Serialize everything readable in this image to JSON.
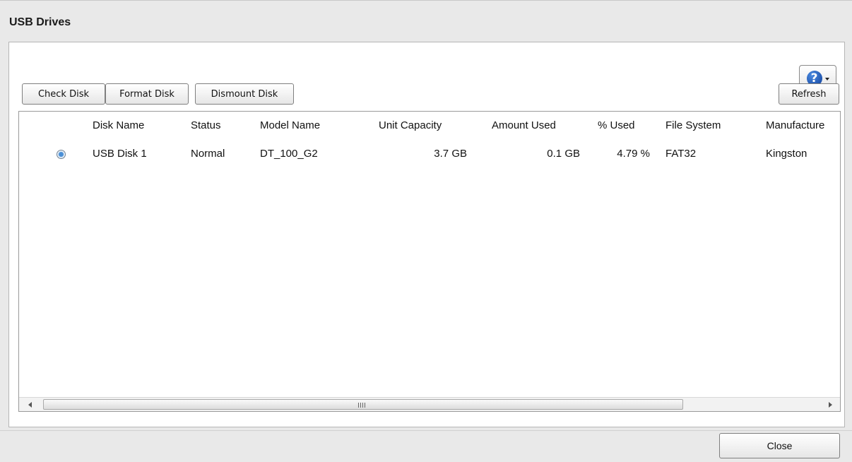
{
  "dialog": {
    "title": "USB Drives",
    "close_label": "Close"
  },
  "toolbar": {
    "check_disk_label": "Check Disk",
    "format_disk_label": "Format Disk",
    "dismount_disk_label": "Dismount Disk",
    "refresh_label": "Refresh",
    "help_icon": "question-icon"
  },
  "table": {
    "columns": [
      "Disk Name",
      "Status",
      "Model Name",
      "Unit Capacity",
      "Amount Used",
      "% Used",
      "File System",
      "Manufacture"
    ],
    "rows": [
      {
        "selected": true,
        "disk_name": "USB Disk 1",
        "status": "Normal",
        "model_name": "DT_100_G2",
        "unit_capacity": "3.7 GB",
        "amount_used": "0.1 GB",
        "percent_used": "4.79 %",
        "file_system": "FAT32",
        "manufacturer": "Kingston"
      }
    ],
    "scrollbar_grip": "III"
  },
  "colors": {
    "background": "#e9e9e9",
    "panel": "#ffffff",
    "accent": "#1f5fbf"
  }
}
